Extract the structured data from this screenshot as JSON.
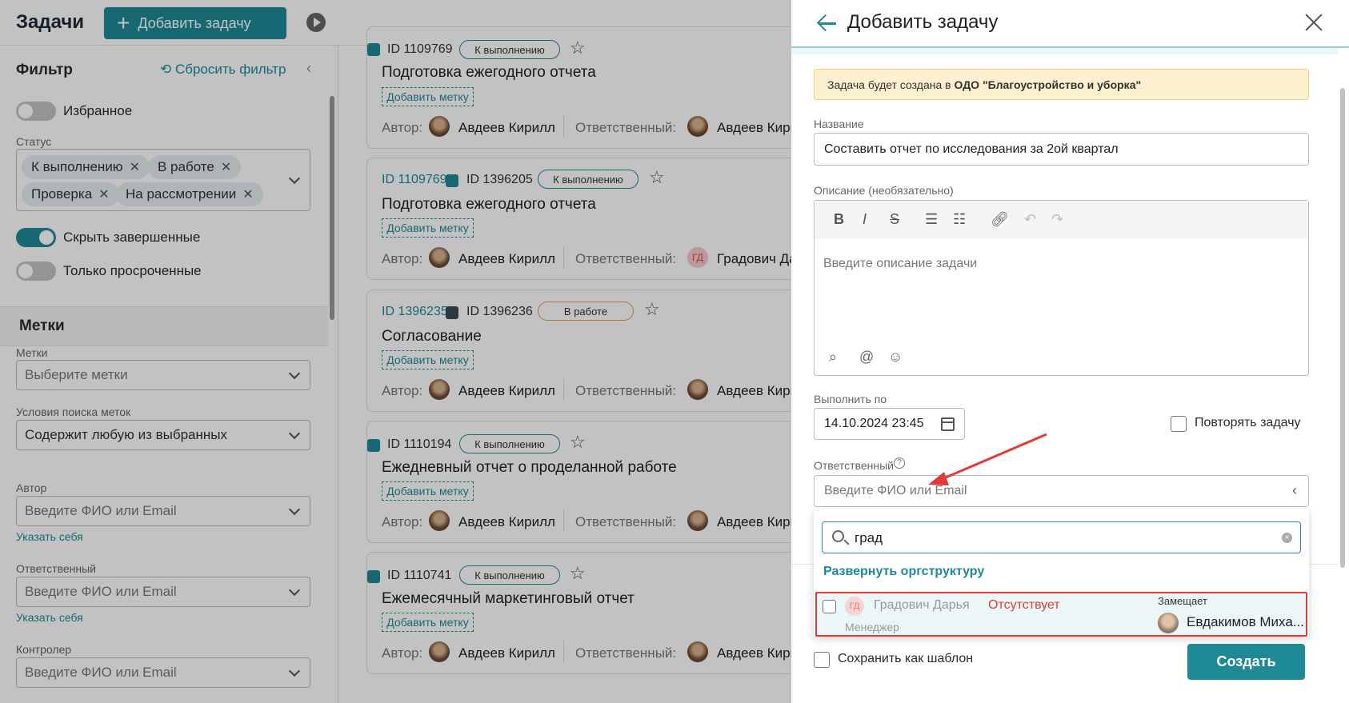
{
  "app": {
    "title": "Задачи",
    "add_button": "Добавить задачу"
  },
  "filter": {
    "title": "Фильтр",
    "reset": "Сбросить фильтр",
    "favorites": "Избранное",
    "status_label": "Статус",
    "status_chips": [
      "К выполнению",
      "В работе",
      "Проверка",
      "На рассмотрении"
    ],
    "hide_completed": "Скрыть завершенные",
    "only_overdue": "Только просроченные",
    "tags_section": "Метки",
    "tags_label": "Метки",
    "tags_placeholder": "Выберите метки",
    "tag_search_label": "Условия поиска меток",
    "tag_search_value": "Содержит любую из выбранных",
    "author_label": "Автор",
    "author_placeholder": "Введите ФИО или Email",
    "assign_self_1": "Указать себя",
    "responsible_label": "Ответственный",
    "responsible_placeholder": "Введите ФИО или Email",
    "assign_self_2": "Указать себя",
    "controller_label": "Контролер",
    "controller_placeholder": "Введите ФИО или Email"
  },
  "cards": [
    {
      "id1": "",
      "id2": "ID 1109769",
      "status": "К выполнению",
      "title": "Подготовка ежегодного отчета",
      "tag": "Добавить метку",
      "author_label": "Автор:",
      "author": "Авдеев Кирилл",
      "resp_label": "Ответственный:",
      "resp": "Авдеев Кирилл"
    },
    {
      "id1": "ID 1109769",
      "id2": "ID 1396205",
      "status": "К выполнению",
      "title": "Подготовка ежегодного отчета",
      "tag": "Добавить метку",
      "author_label": "Автор:",
      "author": "Авдеев Кирилл",
      "resp_label": "Ответственный:",
      "resp": "Градович Дарья",
      "resp_initials": "ГД"
    },
    {
      "id1": "ID 1396235",
      "id2": "ID 1396236",
      "status": "В работе",
      "title": "Согласование",
      "tag": "Добавить метку",
      "author_label": "Автор:",
      "author": "Авдеев Кирилл",
      "resp_label": "Ответственный:",
      "resp": "Авдеев Кирилл"
    },
    {
      "id1": "",
      "id2": "ID 1110194",
      "status": "К выполнению",
      "title": "Ежедневный отчет о проделанной работе",
      "tag": "Добавить метку",
      "author_label": "Автор:",
      "author": "Авдеев Кирилл",
      "resp_label": "Ответственный:",
      "resp": "Авдеев Кирилл"
    },
    {
      "id1": "",
      "id2": "ID 1110741",
      "status": "К выполнению",
      "title": "Ежемесячный маркетинговый отчет",
      "tag": "Добавить метку",
      "author_label": "Автор:",
      "author": "Авдеев Кирилл",
      "resp_label": "Ответственный:",
      "resp": "Авдеев Кирилл"
    }
  ],
  "panel": {
    "title": "Добавить задачу",
    "notice_prefix": "Задача будет создана в",
    "notice_org": "ОДО \"Благоустройство и уборка\"",
    "name_label": "Название",
    "name_value": "Составить отчет по исследования за 2ой квартал",
    "desc_label": "Описание (необязательно)",
    "desc_placeholder": "Введите описание задачи",
    "due_label": "Выполнить по",
    "due_value": "14.10.2024 23:45",
    "repeat": "Повторять задачу",
    "resp_label": "Ответственный",
    "resp_placeholder": "Введите ФИО или Email",
    "search_query": "град",
    "expand_org": "Развернуть оргструктуру",
    "option": {
      "initials": "ГД",
      "name": "Градович Дарья",
      "status": "Отсутствует",
      "role": "Менеджер",
      "deputy_label": "Замещает",
      "deputy_name": "Евдакимов Миха..."
    },
    "save_template": "Сохранить как шаблон",
    "create": "Создать"
  },
  "colors": {
    "accent": "#1e8a96",
    "alert": "#e53935",
    "notice_bg": "#fdf0cf"
  }
}
